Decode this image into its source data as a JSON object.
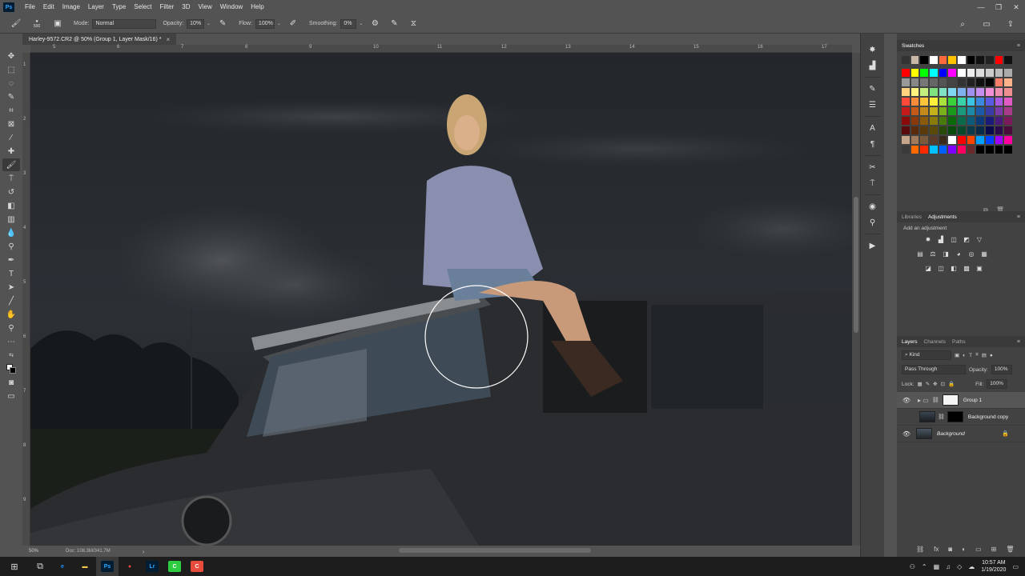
{
  "app": {
    "logo": "Ps",
    "window_controls": [
      "—",
      "❐",
      "✕"
    ]
  },
  "menu": [
    "File",
    "Edit",
    "Image",
    "Layer",
    "Type",
    "Select",
    "Filter",
    "3D",
    "View",
    "Window",
    "Help"
  ],
  "options": {
    "brush_size": "500",
    "mode_label": "Mode:",
    "mode_value": "Normal",
    "opacity_label": "Opacity:",
    "opacity_value": "10%",
    "flow_label": "Flow:",
    "flow_value": "100%",
    "smoothing_label": "Smoothing:",
    "smoothing_value": "0%"
  },
  "document": {
    "tab_title": "Harley-9572.CR2 @ 50% (Group 1, Layer Mask/16) *",
    "close_glyph": "×"
  },
  "ruler": {
    "top": [
      "5",
      "6",
      "7",
      "8",
      "9",
      "10",
      "11",
      "12",
      "13",
      "14",
      "15",
      "16",
      "17"
    ],
    "left": [
      "1",
      "2",
      "3",
      "4",
      "5",
      "6",
      "7",
      "8",
      "9"
    ]
  },
  "status": {
    "zoom": "50%",
    "doc_info": "Doc: 108.3M/341.7M",
    "arrow": "›"
  },
  "panels": {
    "swatches_title": "Swatches",
    "libraries_tab": "Libraries",
    "adjustments_tab": "Adjustments",
    "adjustments_hint": "Add an adjustment",
    "layers_tab": "Layers",
    "channels_tab": "Channels",
    "paths_tab": "Paths",
    "kind_label": "Kind",
    "blend_mode": "Pass Through",
    "opacity_label": "Opacity:",
    "opacity_value": "100%",
    "lock_label": "Lock:",
    "fill_label": "Fill:",
    "fill_value": "100%"
  },
  "layers": [
    {
      "name": "Group 1",
      "visible": true,
      "selected": true
    },
    {
      "name": "Background copy",
      "visible": false,
      "selected": false
    },
    {
      "name": "Background",
      "visible": true,
      "selected": false,
      "locked": true
    }
  ],
  "swatches": {
    "row1": [
      "#333333",
      "#c9b8a8",
      "#000000",
      "#ffffff",
      "#ff6a3c",
      "#ffc200",
      "#ffffff",
      "#000000",
      "#111111",
      "#222222",
      "#ff0000",
      "#111111"
    ],
    "row2": [
      "#ff0000",
      "#ffff00",
      "#00ff00",
      "#00ffff",
      "#0000ff",
      "#ff00ff",
      "#ffffff",
      "#eeeeee",
      "#dddddd",
      "#cccccc",
      "#bbbbbb",
      "#aaaaaa"
    ],
    "row3": [
      "#999999",
      "#888888",
      "#777777",
      "#666666",
      "#555555",
      "#444444",
      "#333333",
      "#222222",
      "#111111",
      "#050505",
      "#ff7f6a",
      "#ffb38a"
    ],
    "row4": [
      "#ffd27f",
      "#fff27f",
      "#c4ef7f",
      "#7fe27f",
      "#7fe2c4",
      "#7fd8ef",
      "#7fb0ef",
      "#9f8fef",
      "#c48fef",
      "#ef8fd8",
      "#ef8fb0",
      "#ef8f8f"
    ],
    "row5": [
      "#ff4a3a",
      "#ff8a3a",
      "#ffc43a",
      "#fff03a",
      "#a8e23a",
      "#3ad23a",
      "#3ad2a8",
      "#3ac4e2",
      "#3a8ae2",
      "#5a5ae2",
      "#a85ae2",
      "#e25ac4"
    ],
    "row6": [
      "#c41a1a",
      "#c45a1a",
      "#c48a1a",
      "#c4b01a",
      "#7ab01a",
      "#1a9a1a",
      "#1a9a7a",
      "#1a8aa8",
      "#1a5aa8",
      "#3a3aa8",
      "#7a3aa8",
      "#a83a8a"
    ],
    "row7": [
      "#8a0a0a",
      "#8a3a0a",
      "#8a5a0a",
      "#8a7a0a",
      "#4a7a0a",
      "#0a6a0a",
      "#0a6a4a",
      "#0a5a7a",
      "#0a3a7a",
      "#1a1a7a",
      "#4a1a7a",
      "#7a1a5a"
    ],
    "row8": [
      "#5a0a0a",
      "#5a2a0a",
      "#5a3a0a",
      "#5a4a0a",
      "#2a4a0a",
      "#0a4a0a",
      "#0a4a2a",
      "#0a3a4a",
      "#0a2a4a",
      "#0a0a4a",
      "#2a0a4a",
      "#4a0a3a"
    ],
    "row9": [
      "#c7a58a",
      "#a07a5a",
      "#7a5a3a",
      "#5a3a2a",
      "#3a2a1a",
      "#ffffff",
      "#ff0000",
      "#ff4400",
      "#00a0ff",
      "#0040ff",
      "#a000ff",
      "#ff00a0"
    ],
    "row10": [
      "#3a3a3a",
      "#ff6a00",
      "#ff2a00",
      "#00c0ff",
      "#0060ff",
      "#8000ff",
      "#ff0060",
      "#6a2a2a",
      "#000000",
      "#000000",
      "#000000",
      "#000000"
    ]
  },
  "taskbar": {
    "time": "10:57 AM",
    "date": "1/19/2020",
    "apps": [
      {
        "name": "edge",
        "glyph": "e",
        "color": "#1e90ff"
      },
      {
        "name": "explorer",
        "glyph": "▬",
        "color": "#f2c94c"
      },
      {
        "name": "photoshop",
        "glyph": "Ps",
        "color": "#31a8ff"
      },
      {
        "name": "chrome",
        "glyph": "●",
        "color": "#e8453c"
      },
      {
        "name": "lightroom",
        "glyph": "Lr",
        "color": "#31a8ff"
      },
      {
        "name": "camtasia-green",
        "glyph": "C",
        "color": "#2ecc40"
      },
      {
        "name": "camtasia-red",
        "glyph": "C",
        "color": "#e74c3c"
      }
    ]
  },
  "colors": {
    "accent": "#31a8ff",
    "panel_bg": "#424242",
    "app_bg": "#535353"
  }
}
